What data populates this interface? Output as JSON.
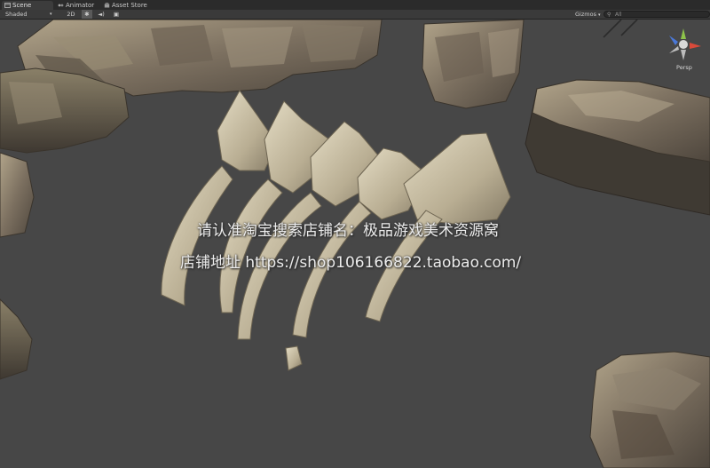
{
  "tabs": [
    {
      "label": "Scene",
      "active": true,
      "icon": "scene-icon"
    },
    {
      "label": "Animator",
      "active": false,
      "icon": "animator-icon"
    },
    {
      "label": "Asset Store",
      "active": false,
      "icon": "store-icon"
    }
  ],
  "toolbar": {
    "shading_mode": "Shaded",
    "mode_2d": "2D",
    "lighting_icon": "sun-icon",
    "audio_icon": "speaker-icon",
    "effects_icon": "image-icon",
    "gizmos_label": "Gizmos",
    "search_placeholder": "All"
  },
  "viewport": {
    "projection": "Persp",
    "background": "#474747"
  },
  "watermark": {
    "line1": "请认准淘宝搜索店铺名：极品游戏美术资源窝",
    "line2": "店铺地址 https://shop106166822.taobao.com/"
  }
}
